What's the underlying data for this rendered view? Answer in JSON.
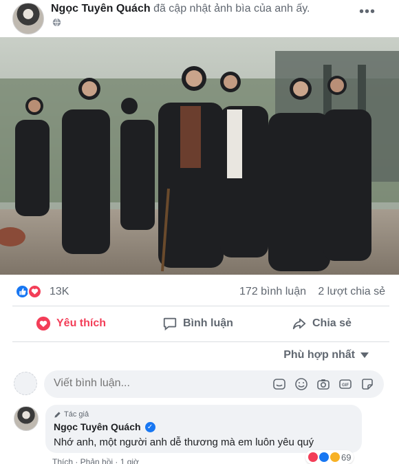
{
  "post": {
    "author": "Ngọc Tuyên Quách",
    "action": "đã cập nhật ảnh bìa của anh ấy.",
    "more_label": "•••"
  },
  "reactions": {
    "count": "13K",
    "comments": "172 bình luận",
    "shares": "2 lượt chia sẻ",
    "icons": [
      "like-icon",
      "love-icon"
    ]
  },
  "actions": {
    "like_label": "Yêu thích",
    "comment_label": "Bình luận",
    "share_label": "Chia sẻ"
  },
  "sort": {
    "label": "Phù hợp nhất"
  },
  "composer": {
    "placeholder": "Viết bình luận...",
    "tools": [
      "sticker-icon",
      "emoji-icon",
      "camera-icon",
      "gif-icon",
      "sticker-smile-icon"
    ]
  },
  "comment": {
    "badge": "Tác giả",
    "author": "Ngọc Tuyên Quách",
    "text": "Nhớ anh, một người anh dễ thương mà em luôn yêu quý",
    "reaction_count": "69",
    "footer": "Thích · Phản hồi · 1 giờ"
  },
  "colors": {
    "accent": "#1877f2",
    "love": "#f33e58",
    "muted_text": "#606770"
  }
}
